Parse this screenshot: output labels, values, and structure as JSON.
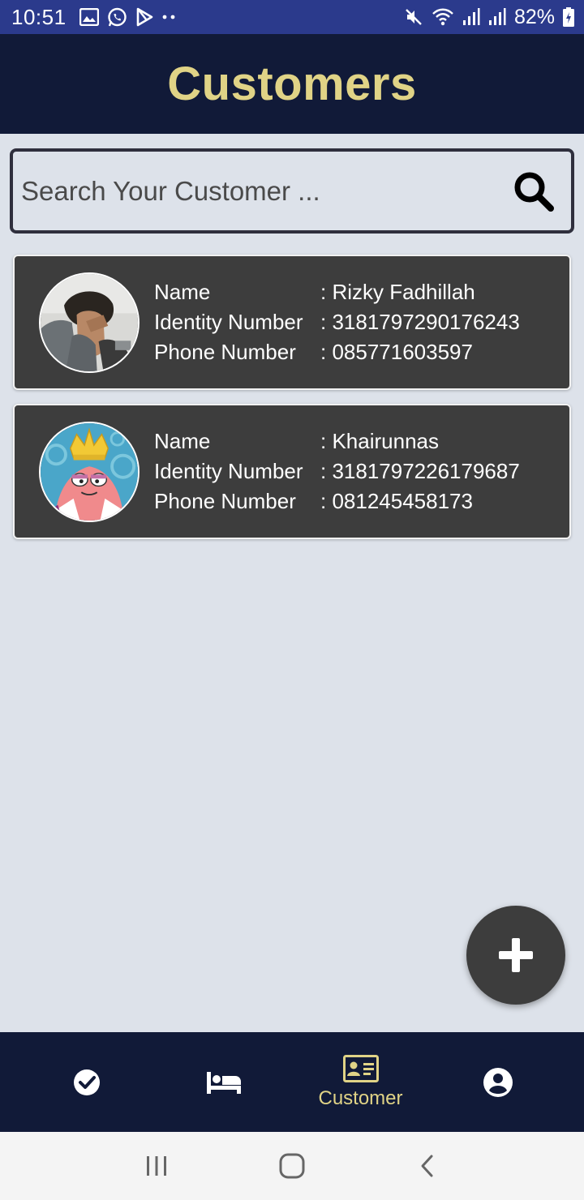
{
  "status_bar": {
    "time": "10:51",
    "battery": "82%",
    "left_icons": [
      "image-icon",
      "whatsapp-icon",
      "play-store-icon",
      "more-dots-icon"
    ],
    "right_icons": [
      "mute-icon",
      "wifi-icon",
      "signal-icon",
      "signal-icon",
      "battery-icon"
    ]
  },
  "header": {
    "title": "Customers",
    "title_color": "#e0d386",
    "background": "#111a38"
  },
  "search": {
    "placeholder": "Search Your Customer ...",
    "value": ""
  },
  "customers": [
    {
      "labels": {
        "name": "Name",
        "identity": "Identity Number",
        "phone": "Phone Number"
      },
      "name": ": Rizky Fadhillah",
      "identity": ": 3181797290176243",
      "phone": ": 085771603597",
      "avatar": "person-photo"
    },
    {
      "labels": {
        "name": "Name",
        "identity": "Identity Number",
        "phone": "Phone Number"
      },
      "name": ": Khairunnas",
      "identity": ": 3181797226179687",
      "phone": ": 081245458173",
      "avatar": "cartoon-king-photo"
    }
  ],
  "fab": {
    "icon": "plus-icon"
  },
  "bottom_nav": {
    "items": [
      {
        "icon": "check-circle-icon",
        "label": ""
      },
      {
        "icon": "bed-icon",
        "label": ""
      },
      {
        "icon": "id-card-icon",
        "label": "Customer",
        "active": true
      },
      {
        "icon": "account-circle-icon",
        "label": ""
      }
    ],
    "active_color": "#e0d386"
  },
  "system_nav": {
    "icons": [
      "recents-icon",
      "home-icon",
      "back-icon"
    ]
  }
}
